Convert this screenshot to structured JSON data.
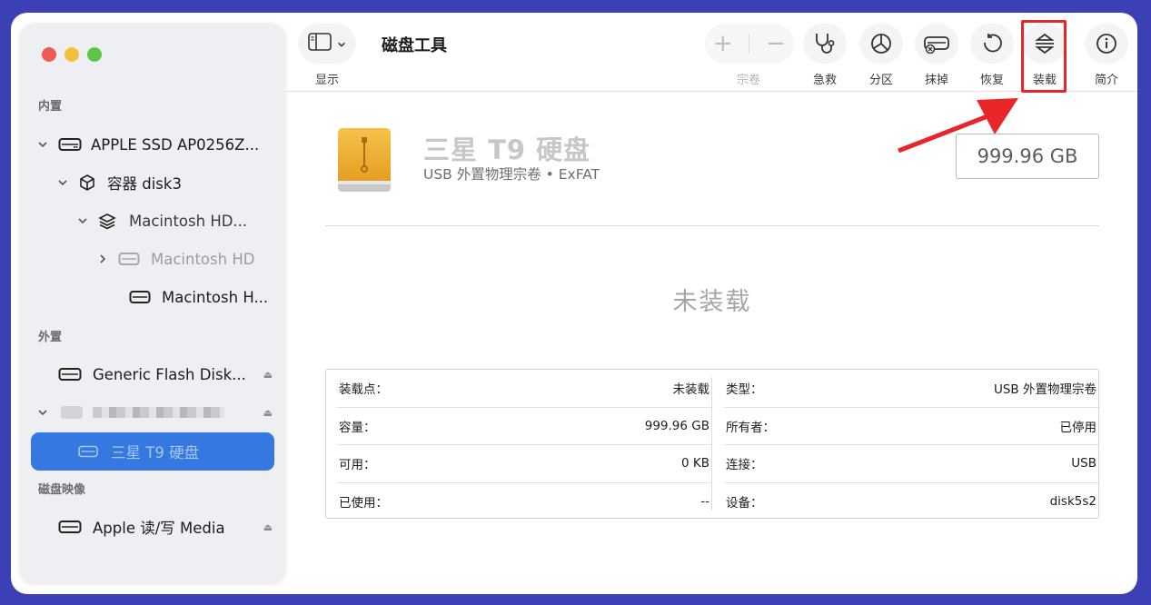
{
  "window": {
    "title": "磁盘工具"
  },
  "colors": {
    "selection": "#3478e0",
    "highlight_box": "#e8262a",
    "background": "#3d3fb4"
  },
  "toolbar": {
    "view_label": "显示",
    "volume_label": "宗卷",
    "first_aid_label": "急救",
    "partition_label": "分区",
    "erase_label": "抹掉",
    "restore_label": "恢复",
    "mount_label": "装载",
    "info_label": "简介",
    "add_glyph": "+",
    "remove_glyph": "−"
  },
  "sidebar": {
    "internal_title": "内置",
    "external_title": "外置",
    "images_title": "磁盘映像",
    "items": [
      {
        "label": "APPLE SSD AP0256Z...",
        "icon": "drive-icon"
      },
      {
        "label": "容器 disk3",
        "icon": "container-icon"
      },
      {
        "label": "Macintosh HD...",
        "icon": "layers-icon"
      },
      {
        "label": "Macintosh HD",
        "icon": "drive-icon"
      },
      {
        "label": "Macintosh H...",
        "icon": "drive-icon"
      },
      {
        "label": "Generic Flash Disk...",
        "icon": "drive-icon"
      },
      {
        "label": "",
        "icon": "drive-icon"
      },
      {
        "label": "三星 T9 硬盘",
        "icon": "drive-icon"
      },
      {
        "label": "Apple 读/写 Media",
        "icon": "drive-icon"
      }
    ]
  },
  "main": {
    "disk_name": "三星 T9 硬盘",
    "disk_subtitle": "USB 外置物理宗卷 • ExFAT",
    "capacity": "999.96 GB",
    "status": "未装载"
  },
  "info": {
    "left": [
      {
        "label": "装载点：",
        "value": "未装载"
      },
      {
        "label": "容量：",
        "value": "999.96 GB"
      },
      {
        "label": "可用：",
        "value": "0 KB"
      },
      {
        "label": "已使用：",
        "value": "--"
      }
    ],
    "right": [
      {
        "label": "类型：",
        "value": "USB 外置物理宗卷"
      },
      {
        "label": "所有者：",
        "value": "已停用"
      },
      {
        "label": "连接：",
        "value": "USB"
      },
      {
        "label": "设备：",
        "value": "disk5s2"
      }
    ]
  }
}
